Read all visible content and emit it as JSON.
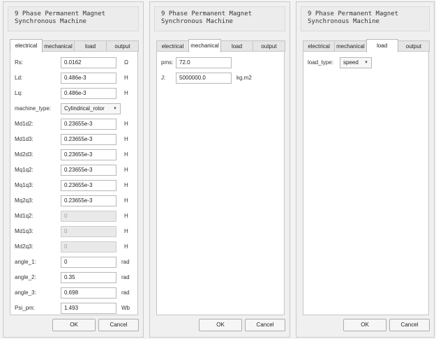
{
  "dialogs": [
    {
      "title": "9 Phase Permanent Magnet\nSynchronous Machine",
      "tabs": [
        "electrical",
        "mechanical",
        "load",
        "output"
      ],
      "active_tab": "electrical",
      "fields": [
        {
          "label": "Rs:",
          "value": "0.0162",
          "unit": "Ω"
        },
        {
          "label": "Ld:",
          "value": "0.486e-3",
          "unit": "H"
        },
        {
          "label": "Lq:",
          "value": "0.486e-3",
          "unit": "H"
        },
        {
          "label": "machine_type:",
          "value": "Cylindrical_rotor",
          "unit": ""
        },
        {
          "label": "Md1d2:",
          "value": "0.23655e-3",
          "unit": "H"
        },
        {
          "label": "Md1d3:",
          "value": "0.23655e-3",
          "unit": "H"
        },
        {
          "label": "Md2d3:",
          "value": "0.23655e-3",
          "unit": "H"
        },
        {
          "label": "Mq1q2:",
          "value": "0.23655e-3",
          "unit": "H"
        },
        {
          "label": "Mq1q3:",
          "value": "0.23655e-3",
          "unit": "H"
        },
        {
          "label": "Mq2q3:",
          "value": "0.23655e-3",
          "unit": "H"
        },
        {
          "label": "Md1q2:",
          "value": "0",
          "unit": "H"
        },
        {
          "label": "Md1q3:",
          "value": "0",
          "unit": "H"
        },
        {
          "label": "Md2q3:",
          "value": "0",
          "unit": "H"
        },
        {
          "label": "angle_1:",
          "value": "0",
          "unit": "rad"
        },
        {
          "label": "angle_2:",
          "value": "0.35",
          "unit": "rad"
        },
        {
          "label": "angle_3:",
          "value": "0.698",
          "unit": "rad"
        },
        {
          "label": "Psi_pm:",
          "value": "1.493",
          "unit": "Wb"
        }
      ],
      "ok_label": "OK",
      "cancel_label": "Cancel"
    },
    {
      "title": "9 Phase Permanent Magnet\nSynchronous Machine",
      "tabs": [
        "electrical",
        "mechanical",
        "load",
        "output"
      ],
      "active_tab": "mechanical",
      "fields": [
        {
          "label": "pms:",
          "value": "72.0",
          "unit": ""
        },
        {
          "label": "J:",
          "value": "5000000.0",
          "unit": "kg.m2"
        }
      ],
      "ok_label": "OK",
      "cancel_label": "Cancel"
    },
    {
      "title": "9 Phase Permanent Magnet\nSynchronous Machine",
      "tabs": [
        "electrical",
        "mechanical",
        "load",
        "output"
      ],
      "active_tab": "load",
      "fields": [
        {
          "label": "load_type:",
          "value": "speed",
          "unit": ""
        }
      ],
      "ok_label": "OK",
      "cancel_label": "Cancel"
    }
  ]
}
